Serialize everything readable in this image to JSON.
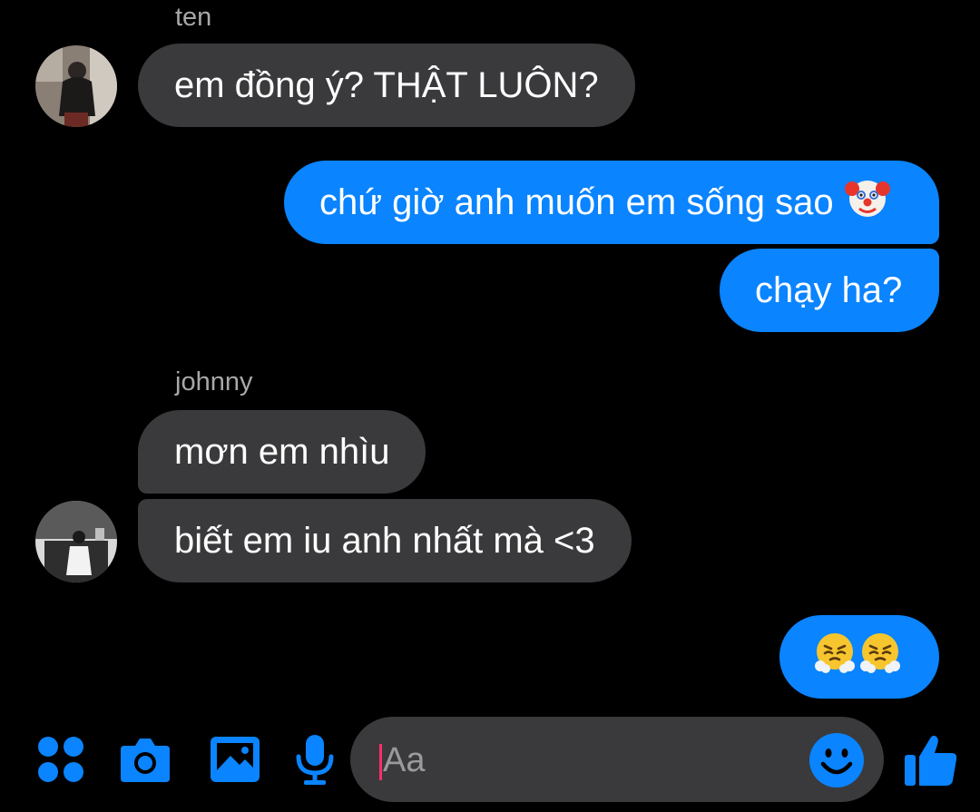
{
  "conversation": {
    "groups": [
      {
        "sender": "ten",
        "messages": [
          "em đồng ý? THẬT LUÔN?"
        ]
      },
      {
        "sender": "me",
        "messages": [
          "chứ giờ anh muốn em sống sao",
          "chạy ha?"
        ],
        "emoji_after_first": "clown-face"
      },
      {
        "sender": "johnny",
        "messages": [
          "mơn em nhìu",
          "biết em iu anh nhất mà <3"
        ]
      },
      {
        "sender": "me",
        "emojis": [
          "face-with-steam-from-nose",
          "face-with-steam-from-nose"
        ]
      }
    ]
  },
  "composer": {
    "placeholder": "Aa",
    "tools": [
      "apps-icon",
      "camera-icon",
      "image-icon",
      "microphone-icon"
    ],
    "emoji_button": "smiley-icon",
    "like_button": "thumbs-up-icon"
  },
  "colors": {
    "background": "#000000",
    "incoming_bubble": "#3a3a3c",
    "outgoing_bubble": "#0a84ff",
    "accent": "#0a84ff",
    "caret": "#ff2d6a"
  }
}
